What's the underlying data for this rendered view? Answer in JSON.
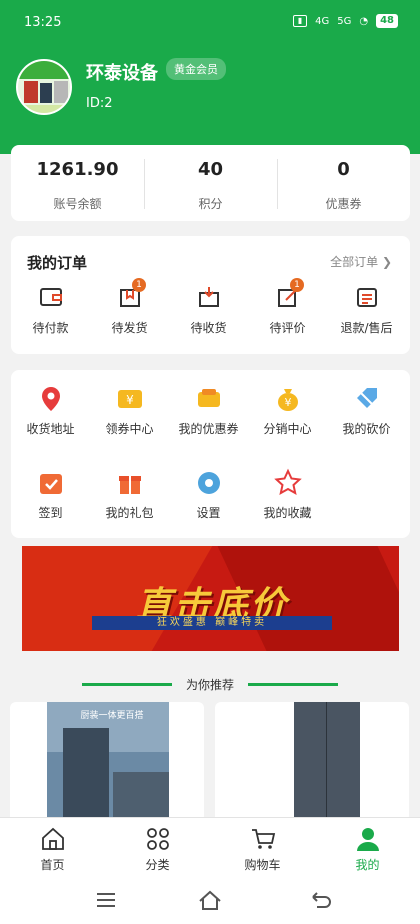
{
  "status_bar": {
    "time": "13:25",
    "battery": "48",
    "network": "4G",
    "network2": "5G"
  },
  "profile": {
    "shop_name": "环泰设备",
    "member_level": "黄金会员",
    "user_id": "ID:2"
  },
  "stats": [
    {
      "value": "1261.90",
      "label": "账号余额"
    },
    {
      "value": "40",
      "label": "积分"
    },
    {
      "value": "0",
      "label": "优惠券"
    }
  ],
  "orders": {
    "title": "我的订单",
    "view_all": "全部订单 ❯",
    "items": [
      {
        "label": "待付款",
        "icon": "wallet-icon",
        "badge": ""
      },
      {
        "label": "待发货",
        "icon": "gift-box-icon",
        "badge": "1"
      },
      {
        "label": "待收货",
        "icon": "delivery-box-icon",
        "badge": ""
      },
      {
        "label": "待评价",
        "icon": "review-icon",
        "badge": "1"
      },
      {
        "label": "退款/售后",
        "icon": "refund-list-icon",
        "badge": ""
      }
    ]
  },
  "services": [
    {
      "label": "收货地址",
      "icon": "location-pin-icon"
    },
    {
      "label": "领券中心",
      "icon": "coupon-icon"
    },
    {
      "label": "我的优惠券",
      "icon": "my-coupon-icon"
    },
    {
      "label": "分销中心",
      "icon": "money-bag-icon"
    },
    {
      "label": "我的砍价",
      "icon": "bargain-tag-icon"
    },
    {
      "label": "签到",
      "icon": "calendar-check-icon"
    },
    {
      "label": "我的礼包",
      "icon": "gift-icon"
    },
    {
      "label": "设置",
      "icon": "settings-icon"
    },
    {
      "label": "我的收藏",
      "icon": "star-favorite-icon"
    }
  ],
  "banner": {
    "headline": "直击底价",
    "subline": "狂欢盛惠 巅峰特卖"
  },
  "recommend": {
    "title": "为你推荐",
    "products": [
      {
        "caption": "厨装一体更百搭"
      },
      {
        "caption": ""
      }
    ]
  },
  "tabbar": [
    {
      "label": "首页",
      "icon": "home-icon",
      "active": false
    },
    {
      "label": "分类",
      "icon": "category-icon",
      "active": false
    },
    {
      "label": "购物车",
      "icon": "cart-icon",
      "active": false
    },
    {
      "label": "我的",
      "icon": "user-icon",
      "active": true
    }
  ],
  "colors": {
    "brand": "#1aaa4a",
    "badge": "#e56a22"
  }
}
